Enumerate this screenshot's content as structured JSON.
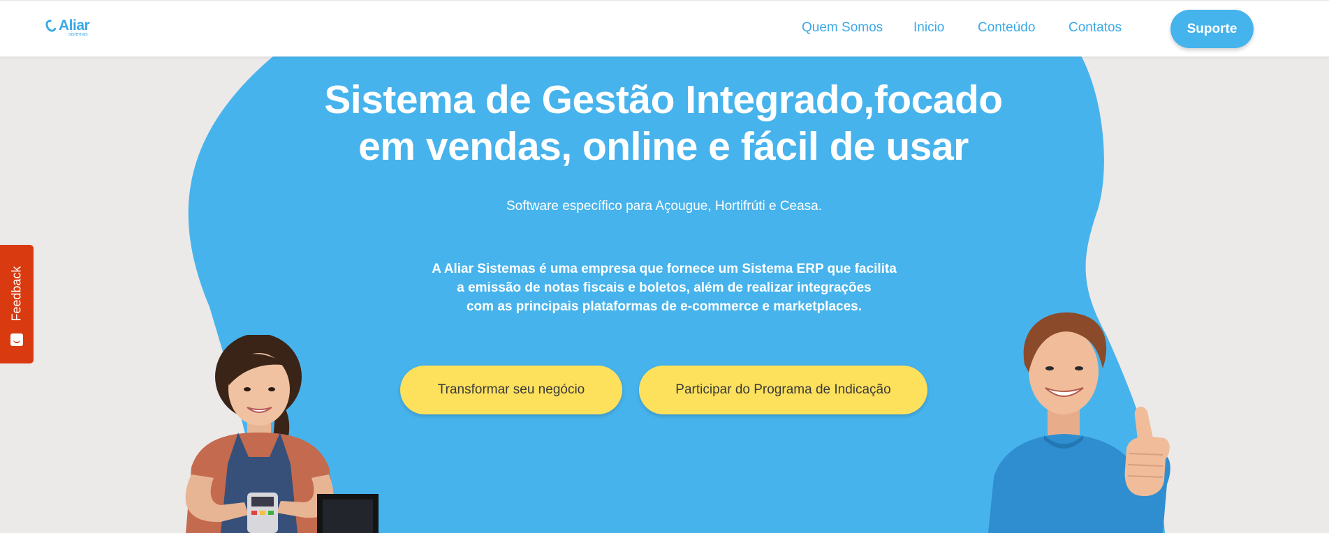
{
  "header": {
    "logo": {
      "name": "Aliar",
      "tagline": "sistemas"
    },
    "nav": [
      {
        "label": "Quem Somos"
      },
      {
        "label": "Inicio"
      },
      {
        "label": "Conteúdo"
      },
      {
        "label": "Contatos"
      }
    ],
    "support_label": "Suporte"
  },
  "hero": {
    "title_line1": "Sistema de Gestão Integrado,focado",
    "title_line2": "em vendas, online e fácil de usar",
    "subtitle": "Software específico para Açougue, Hortifrúti e Ceasa.",
    "description_lines": [
      "A Aliar Sistemas é uma empresa que fornece um Sistema ERP que facilita",
      "a emissão de notas fiscais e boletos, além de realizar integrações",
      "com as principais plataformas de e-commerce e marketplaces."
    ],
    "cta_primary": "Transformar seu negócio",
    "cta_secondary": "Participar do Programa de Indicação"
  },
  "feedback": {
    "label": "Feedback",
    "icon": "smile-icon"
  },
  "colors": {
    "brand_blue": "#45b3ec",
    "cta_yellow": "#fde05c",
    "feedback_red": "#d93a10",
    "page_bg": "#ece9e9"
  }
}
